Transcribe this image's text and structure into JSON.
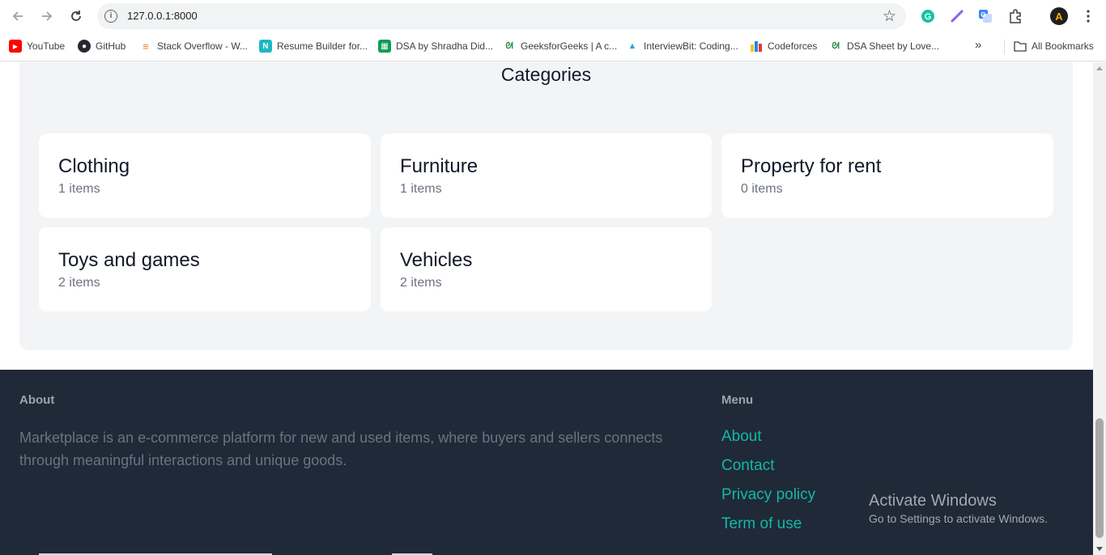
{
  "browser": {
    "url": "127.0.0.1:8000",
    "bookmarks": [
      {
        "label": "YouTube",
        "icon": "youtube-icon"
      },
      {
        "label": "GitHub",
        "icon": "github-icon"
      },
      {
        "label": "Stack Overflow - W...",
        "icon": "stackoverflow-icon"
      },
      {
        "label": "Resume Builder for...",
        "icon": "resume-builder-icon"
      },
      {
        "label": "DSA by Shradha Did...",
        "icon": "sheets-icon"
      },
      {
        "label": "GeeksforGeeks | A c...",
        "icon": "geeksforgeeks-icon"
      },
      {
        "label": "InterviewBit: Coding...",
        "icon": "interviewbit-icon"
      },
      {
        "label": "Codeforces",
        "icon": "codeforces-icon"
      },
      {
        "label": "DSA Sheet by Love...",
        "icon": "geeksforgeeks-icon"
      }
    ],
    "all_bookmarks": "All Bookmarks",
    "profile_initial": "A"
  },
  "categories": {
    "title": "Categories",
    "items": [
      {
        "name": "Clothing",
        "count": "1 items"
      },
      {
        "name": "Furniture",
        "count": "1 items"
      },
      {
        "name": "Property for rent",
        "count": "0 items"
      },
      {
        "name": "Toys and games",
        "count": "2 items"
      },
      {
        "name": "Vehicles",
        "count": "2 items"
      }
    ]
  },
  "footer": {
    "about_heading": "About",
    "about_text": "Marketplace is an e-commerce platform for new and used items, where buyers and sellers connects through meaningful interactions and unique goods.",
    "menu_heading": "Menu",
    "menu_links": [
      "About",
      "Contact",
      "Privacy policy",
      "Term of use"
    ]
  },
  "watermark": {
    "line1": "Activate Windows",
    "line2": "Go to Settings to activate Windows."
  },
  "colors": {
    "accent": "#14b8a6",
    "footer_bg": "#1f2937",
    "section_bg": "#f3f4f6"
  }
}
